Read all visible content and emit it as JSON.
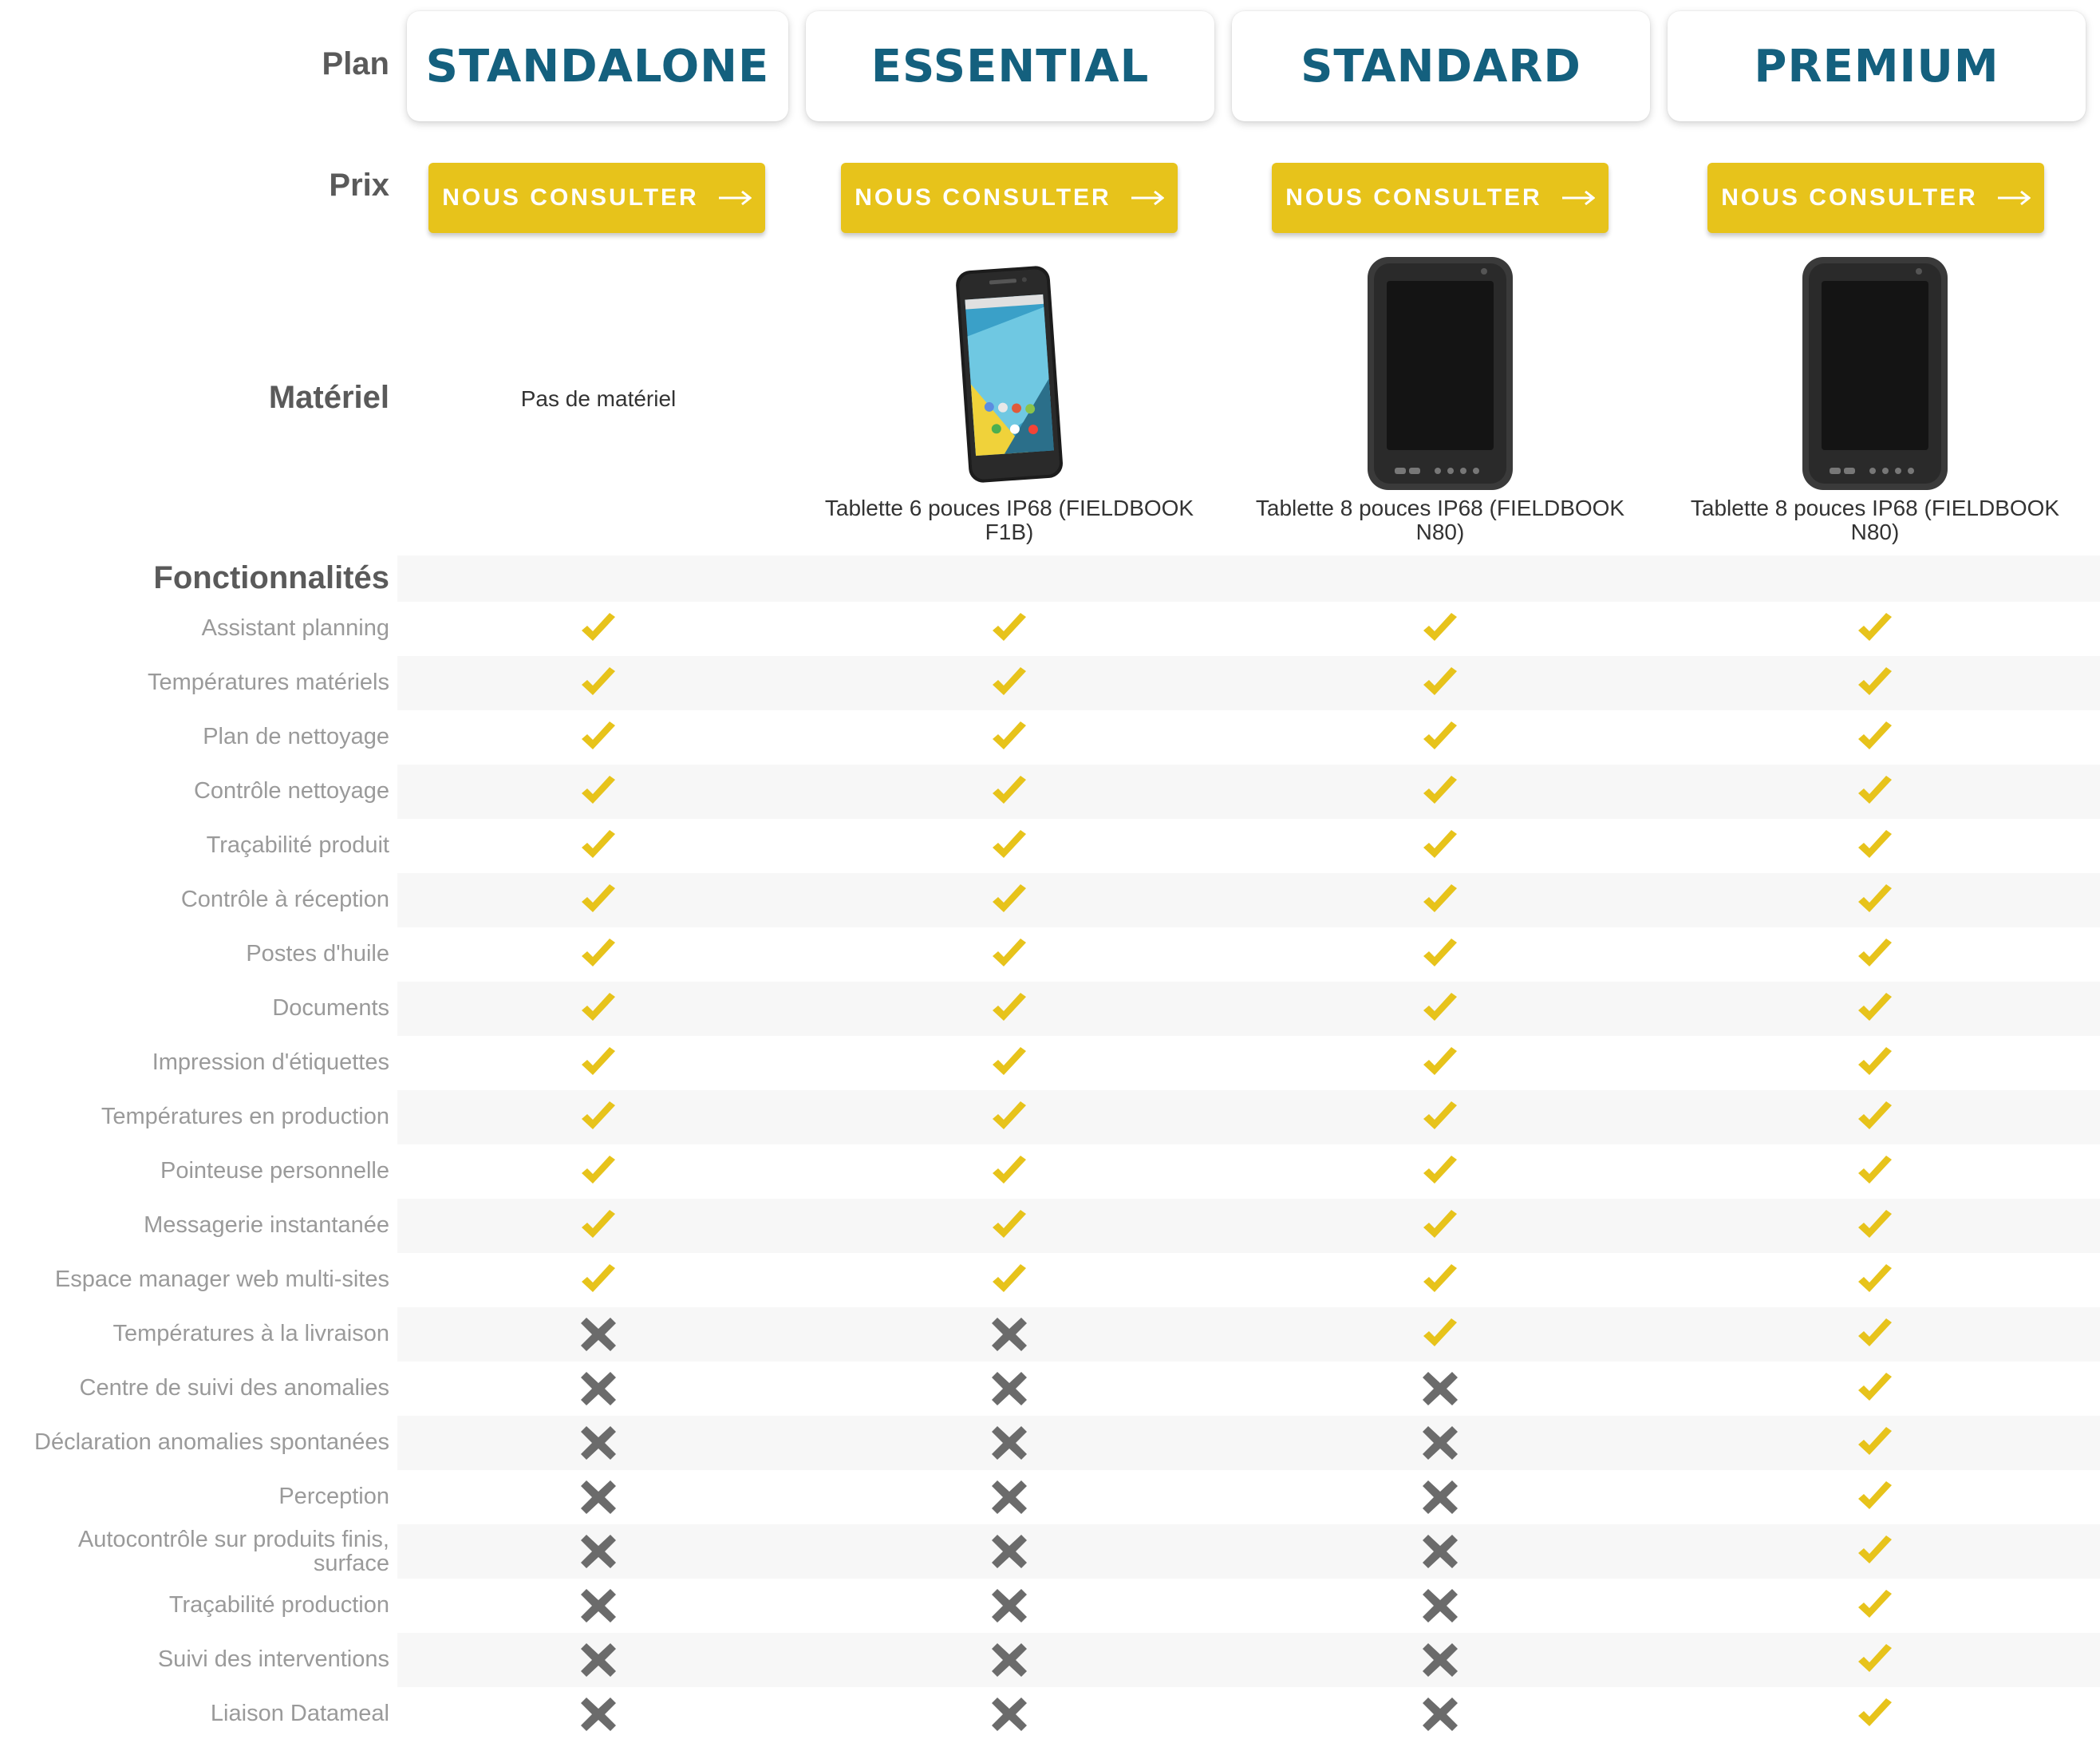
{
  "header": {
    "plan_label": "Plan",
    "price_label": "Prix",
    "material_label": "Matériel",
    "features_label": "Fonctionnalités"
  },
  "plans": [
    {
      "name": "STANDALONE",
      "cta": "NOUS CONSULTER",
      "material": "Pas de matériel",
      "device": "none"
    },
    {
      "name": "ESSENTIAL",
      "cta": "NOUS CONSULTER",
      "material": "Tablette 6 pouces IP68 (FIELDBOOK F1B)",
      "device": "phone"
    },
    {
      "name": "STANDARD",
      "cta": "NOUS CONSULTER",
      "material": "Tablette 8 pouces IP68 (FIELDBOOK N80)",
      "device": "tablet"
    },
    {
      "name": "PREMIUM",
      "cta": "NOUS CONSULTER",
      "material": "Tablette 8 pouces IP68 (FIELDBOOK N80)",
      "device": "tablet"
    }
  ],
  "features": [
    {
      "name": "Assistant planning",
      "values": [
        true,
        true,
        true,
        true
      ]
    },
    {
      "name": "Températures matériels",
      "values": [
        true,
        true,
        true,
        true
      ]
    },
    {
      "name": "Plan de nettoyage",
      "values": [
        true,
        true,
        true,
        true
      ]
    },
    {
      "name": "Contrôle nettoyage",
      "values": [
        true,
        true,
        true,
        true
      ]
    },
    {
      "name": "Traçabilité produit",
      "values": [
        true,
        true,
        true,
        true
      ]
    },
    {
      "name": "Contrôle à réception",
      "values": [
        true,
        true,
        true,
        true
      ]
    },
    {
      "name": "Postes d'huile",
      "values": [
        true,
        true,
        true,
        true
      ]
    },
    {
      "name": "Documents",
      "values": [
        true,
        true,
        true,
        true
      ]
    },
    {
      "name": "Impression d'étiquettes",
      "values": [
        true,
        true,
        true,
        true
      ]
    },
    {
      "name": "Températures en production",
      "values": [
        true,
        true,
        true,
        true
      ]
    },
    {
      "name": "Pointeuse personnelle",
      "values": [
        true,
        true,
        true,
        true
      ]
    },
    {
      "name": "Messagerie instantanée",
      "values": [
        true,
        true,
        true,
        true
      ]
    },
    {
      "name": "Espace manager web multi-sites",
      "values": [
        true,
        true,
        true,
        true
      ]
    },
    {
      "name": "Températures à la livraison",
      "values": [
        false,
        false,
        true,
        true
      ]
    },
    {
      "name": "Centre de suivi des anomalies",
      "values": [
        false,
        false,
        false,
        true
      ]
    },
    {
      "name": "Déclaration anomalies spontanées",
      "values": [
        false,
        false,
        false,
        true
      ]
    },
    {
      "name": "Perception",
      "values": [
        false,
        false,
        false,
        true
      ]
    },
    {
      "name": "Autocontrôle sur produits finis, surface",
      "values": [
        false,
        false,
        false,
        true
      ]
    },
    {
      "name": "Traçabilité production",
      "values": [
        false,
        false,
        false,
        true
      ]
    },
    {
      "name": "Suivi des interventions",
      "values": [
        false,
        false,
        false,
        true
      ]
    },
    {
      "name": "Liaison Datameal",
      "values": [
        false,
        false,
        false,
        true
      ]
    }
  ],
  "icons": {
    "included": "check-icon",
    "excluded": "cross-icon"
  },
  "colors": {
    "plan_name": "#14607e",
    "cta_background": "#e7c31b",
    "check": "#e7c31b",
    "cross": "#6b6b6b",
    "feature_text": "#9a9a9a",
    "row_stripe": "#f7f7f7"
  }
}
